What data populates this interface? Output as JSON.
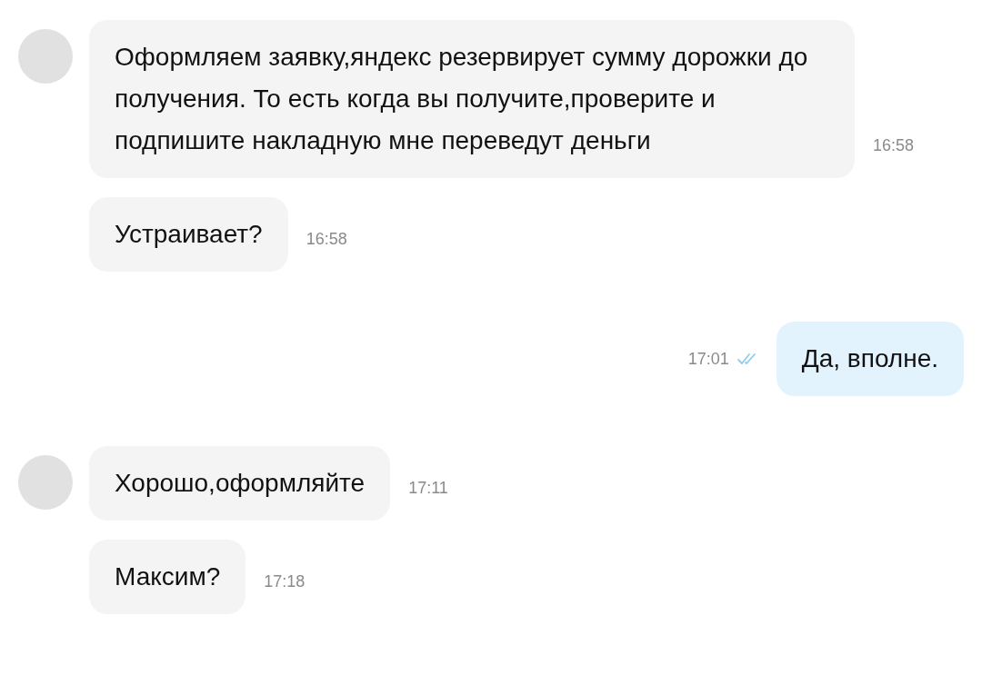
{
  "messages": [
    {
      "kind": "incoming",
      "avatar": true,
      "text": "Оформляем заявку,яндекс резервирует сумму дорожки до получения. То есть когда вы получите,проверите и подпишите накладную мне переведут деньги",
      "time": "16:58"
    },
    {
      "kind": "incoming",
      "avatar": false,
      "text": "Устраивает?",
      "time": "16:58"
    },
    {
      "kind": "outgoing",
      "avatar": false,
      "text": "Да, вполне.",
      "time": "17:01",
      "read": true
    },
    {
      "kind": "incoming",
      "avatar": true,
      "text": "Хорошо,оформляйте",
      "time": "17:11"
    },
    {
      "kind": "incoming",
      "avatar": false,
      "text": "Максим?",
      "time": "17:18"
    }
  ]
}
